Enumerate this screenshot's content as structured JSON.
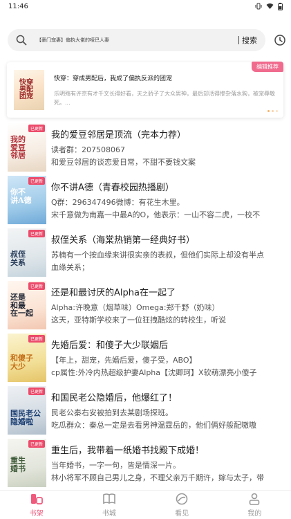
{
  "status": {
    "time": "11:46",
    "icons": [
      "vibrate-icon",
      "wifi-icon",
      "battery-icon"
    ]
  },
  "search": {
    "text": "【豪门宠妻】偏执大佬的哑巴人妻",
    "button_label": "搜索"
  },
  "featured": {
    "tag": "编辑推荐",
    "title": "快穿：穿成男配后，我成了偏执反派的团宠",
    "description": "乐明殇有许京有才千文长得好看，天之骄子了大众男神，最后却活得惨杂落水狗，被宠辱敬死。..."
  },
  "books": [
    {
      "title": "我的爱豆邻居是顶流（完本力荐）",
      "line1": "读者群：207508067",
      "line2": "和爱豆邻居的谈恋爱日常，不甜不要钱文案",
      "cover_tag": "已更新"
    },
    {
      "title": "你不讲A德（青春校园热播剧）",
      "line1": "Q群：296347496微博：有花生木里。",
      "line2": "宋千意做为南嘉一中最A的O，他表示：一山不容二虎，一校不",
      "cover_tag": "已更新"
    },
    {
      "title": "叔侄关系（海棠热销第一经典好书）",
      "line1": "苏楠有一个按血缘来讲很实亲的表叔，但他们实际上却没有半点",
      "line2": "血缘关系；",
      "cover_tag": "已更新"
    },
    {
      "title": "还是和最讨厌的Alpha在一起了",
      "line1": "    Alpha:许晚意（烟草味）Omega:郑千野（奶味）",
      "line2": "    这天，亚特斯学校来了一位狂拽酷炫的转校生，听说",
      "cover_tag": "已更新"
    },
    {
      "title": "先婚后爱：和傻子大少联姻后",
      "line1": "【年上，甜宠，先婚后爱，傻子受，ABO】",
      "line2": "cp属性:外冷内热超级护妻Alpha【沈卿珂】X软萌漂亮小傻子",
      "cover_tag": "已更新"
    },
    {
      "title": "和国民老公隐婚后，他爆红了！",
      "line1": "民老公秦右安被拍到去某剧场探班。",
      "line2": "吃瓜群众：秦总一定是去看男神温霆岳的，他们俩好般配嗷嗷",
      "cover_tag": "已更新"
    },
    {
      "title": "重生后，我带着一纸婚书找殿下成婚！",
      "line1": "当年婚书，一字一句，皆是情深一片。",
      "line2": "林小将军不顾自己男儿之身，不理父亲万千期许，嫁与太子，带",
      "cover_tag": "已更新"
    }
  ],
  "nav": [
    {
      "label": "书架",
      "icon": "bookshelf-icon"
    },
    {
      "label": "书城",
      "icon": "book-city-icon"
    },
    {
      "label": "看见",
      "icon": "discover-icon"
    },
    {
      "label": "我的",
      "icon": "profile-icon"
    }
  ],
  "colors": {
    "accent": "#ef5a7d",
    "tag": "#f06b8e",
    "cover_tag": "#ec4b6b"
  }
}
